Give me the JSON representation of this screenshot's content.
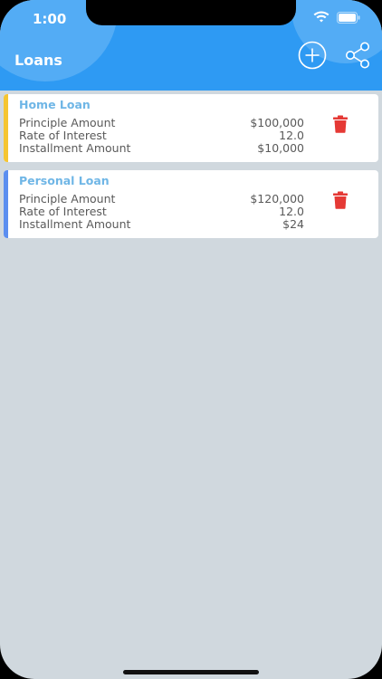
{
  "status_bar": {
    "time": "1:00"
  },
  "header": {
    "title": "Loans",
    "add_icon": "plus-circle-icon",
    "share_icon": "share-icon",
    "color": "#2e9af3"
  },
  "loans": [
    {
      "name": "Home Loan",
      "accent_color": "#f5c531",
      "principle_label": "Principle Amount",
      "principle_value": "$100,000",
      "rate_label": "Rate of Interest",
      "rate_value": "12.0",
      "installment_label": "Installment Amount",
      "installment_value": "$10,000",
      "delete_icon": "trash-icon"
    },
    {
      "name": "Personal Loan",
      "accent_color": "#5b8ef0",
      "principle_label": "Principle Amount",
      "principle_value": "$120,000",
      "rate_label": "Rate of Interest",
      "rate_value": "12.0",
      "installment_label": "Installment Amount",
      "installment_value": "$24",
      "delete_icon": "trash-icon"
    }
  ],
  "colors": {
    "loan_name": "#6fb6e6",
    "delete": "#e53935",
    "background": "#d0d8de"
  }
}
